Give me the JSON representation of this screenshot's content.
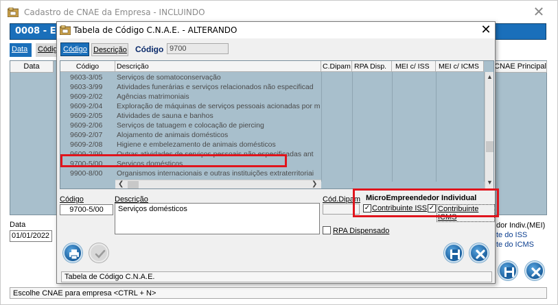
{
  "outer": {
    "title": "Cadastro de CNAE da Empresa   -   INCLUINDO",
    "header_code": "0008   -   E",
    "tabs": [
      {
        "label": "Data"
      },
      {
        "label": "Códig"
      }
    ],
    "grid_headers": {
      "data": "Data",
      "cnae": "CNAE Principal"
    },
    "data_label": "Data",
    "data_value": "01/01/2022",
    "mei_lines": [
      "dor Indiv.(MEI)",
      "te do ISS",
      "te do ICMS"
    ],
    "status": "Escolhe CNAE para empresa  <CTRL + N>"
  },
  "dialog": {
    "title": "Tabela de Código C.N.A.E.   -   ALTERANDO",
    "tabs": {
      "codigo": "Código",
      "descricao": "Descrição"
    },
    "search": {
      "label": "Código",
      "value": "9700"
    },
    "columns": {
      "codigo": "Código",
      "descricao": "Descrição",
      "cdipam": "C.Dipam",
      "rpa": "RPA  Disp.",
      "mei_iss": "MEI  c/ ISS",
      "mei_icms": "MEI  c/ ICMS"
    },
    "rows": [
      {
        "code": "9603-3/05",
        "desc": "Serviços de somatoconservação"
      },
      {
        "code": "9603-3/99",
        "desc": "Atividades funerárias e serviços relacionados não especificad"
      },
      {
        "code": "9609-2/02",
        "desc": "Agências matrimoniais"
      },
      {
        "code": "9609-2/04",
        "desc": "Exploração de máquinas de serviços pessoais acionadas por m"
      },
      {
        "code": "9609-2/05",
        "desc": "Atividades de sauna e banhos"
      },
      {
        "code": "9609-2/06",
        "desc": "Serviços de tatuagem e colocação de piercing"
      },
      {
        "code": "9609-2/07",
        "desc": "Alojamento de animais domésticos"
      },
      {
        "code": "9609-2/08",
        "desc": "Higiene e embelezamento de animais domésticos"
      },
      {
        "code": "9609-2/99",
        "desc": "Outras atividades de serviços pessoais não especificadas ant"
      },
      {
        "code": "9700-5/00",
        "desc": "Serviços domésticos"
      },
      {
        "code": "9900-8/00",
        "desc": "Organismos internacionais e outras instituições extraterritoriai"
      }
    ],
    "form": {
      "codigo_label": "Código",
      "codigo_value": "9700-5/00",
      "descricao_label": "Descrição",
      "descricao_value": "Serviços domésticos",
      "cdipam_label": "Cód.Dipam",
      "cdipam_value": "",
      "rpa_label": "RPA Dispensado",
      "mei_title": "MicroEmpreendedor Individual",
      "iss_label": "Contribuinte ISS",
      "icms_label": "Contribuinte ICMS",
      "iss_checked": "✓",
      "icms_checked": "✓"
    },
    "status": "Tabela de Código C.N.A.E."
  },
  "colors": {
    "accent": "#1a6fba",
    "grid_bg": "#a8bfcc",
    "highlight": "#e0141c"
  }
}
